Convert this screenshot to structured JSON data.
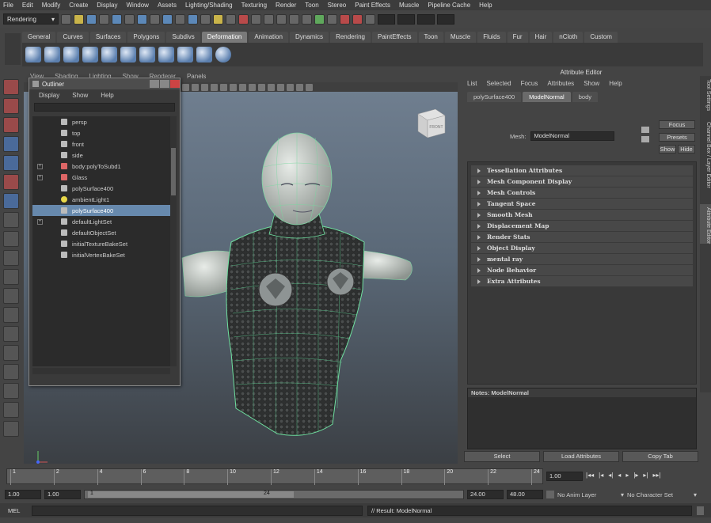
{
  "menubar": [
    "File",
    "Edit",
    "Modify",
    "Create",
    "Display",
    "Window",
    "Assets",
    "Lighting/Shading",
    "Texturing",
    "Render",
    "Toon",
    "Stereo",
    "Paint Effects",
    "Muscle",
    "Pipeline Cache",
    "Help"
  ],
  "status": {
    "mode": "Rendering"
  },
  "shelf_tabs": [
    "General",
    "Curves",
    "Surfaces",
    "Polygons",
    "Subdivs",
    "Deformation",
    "Animation",
    "Dynamics",
    "Rendering",
    "PaintEffects",
    "Toon",
    "Muscle",
    "Fluids",
    "Fur",
    "Hair",
    "nCloth",
    "Custom"
  ],
  "shelf_active": "Deformation",
  "panel": {
    "menu": [
      "View",
      "Shading",
      "Lighting",
      "Show",
      "Renderer",
      "Panels"
    ]
  },
  "viewcube": {
    "label": "FRONT"
  },
  "outliner": {
    "title": "Outliner",
    "menu": [
      "Display",
      "Show",
      "Help"
    ],
    "items": [
      {
        "label": "persp",
        "icon": "camera-icon",
        "expandable": false,
        "selected": false
      },
      {
        "label": "top",
        "icon": "camera-icon",
        "expandable": false,
        "selected": false
      },
      {
        "label": "front",
        "icon": "camera-icon",
        "expandable": false,
        "selected": false
      },
      {
        "label": "side",
        "icon": "camera-icon",
        "expandable": false,
        "selected": false
      },
      {
        "label": "body:polyToSubd1",
        "icon": "subdiv-icon",
        "expandable": true,
        "selected": false
      },
      {
        "label": "Glass",
        "icon": "subdiv-icon",
        "expandable": true,
        "selected": false
      },
      {
        "label": "polySurface400",
        "icon": "mesh-icon",
        "expandable": false,
        "selected": false
      },
      {
        "label": "ambientLight1",
        "icon": "light-icon",
        "expandable": false,
        "selected": false
      },
      {
        "label": "polySurface400",
        "icon": "mesh-icon",
        "expandable": false,
        "selected": true
      },
      {
        "label": "defaultLightSet",
        "icon": "set-icon",
        "expandable": true,
        "selected": false
      },
      {
        "label": "defaultObjectSet",
        "icon": "set-icon",
        "expandable": false,
        "selected": false
      },
      {
        "label": "initialTextureBakeSet",
        "icon": "set-icon",
        "expandable": false,
        "selected": false
      },
      {
        "label": "initialVertexBakeSet",
        "icon": "set-icon",
        "expandable": false,
        "selected": false
      }
    ]
  },
  "attribute_editor": {
    "title": "Attribute Editor",
    "menu": [
      "List",
      "Selected",
      "Focus",
      "Attributes",
      "Show",
      "Help"
    ],
    "tabs": [
      "polySurface400",
      "ModelNormal",
      "body"
    ],
    "active_tab": "ModelNormal",
    "mesh_label": "Mesh:",
    "mesh_value": "ModelNormal",
    "focus_button": "Focus",
    "presets_button": "Presets",
    "show_button": "Show",
    "hide_button": "Hide",
    "sections": [
      "Tessellation Attributes",
      "Mesh Component Display",
      "Mesh Controls",
      "Tangent Space",
      "Smooth Mesh",
      "Displacement Map",
      "Render Stats",
      "Object Display",
      "mental ray",
      "Node Behavior",
      "Extra Attributes"
    ],
    "notes_label": "Notes: ModelNormal",
    "buttons": [
      "Select",
      "Load Attributes",
      "Copy Tab"
    ]
  },
  "right_tabs": [
    "Tool Settings",
    "Channel Box / Layer Editor",
    "Attribute Editor"
  ],
  "timeslider": {
    "ticks": [
      "1",
      "2",
      "4",
      "6",
      "8",
      "10",
      "12",
      "14",
      "16",
      "18",
      "20",
      "22",
      "24"
    ],
    "current": "1.00"
  },
  "range": {
    "start": "1.00",
    "start2": "1.00",
    "thumb_start": "1",
    "thumb_end": "24",
    "end": "24.00",
    "end2": "48.00",
    "anim_layer": "No Anim Layer",
    "char_set": "No Character Set"
  },
  "cmdline": {
    "label": "MEL",
    "result": "// Result: ModelNormal"
  }
}
